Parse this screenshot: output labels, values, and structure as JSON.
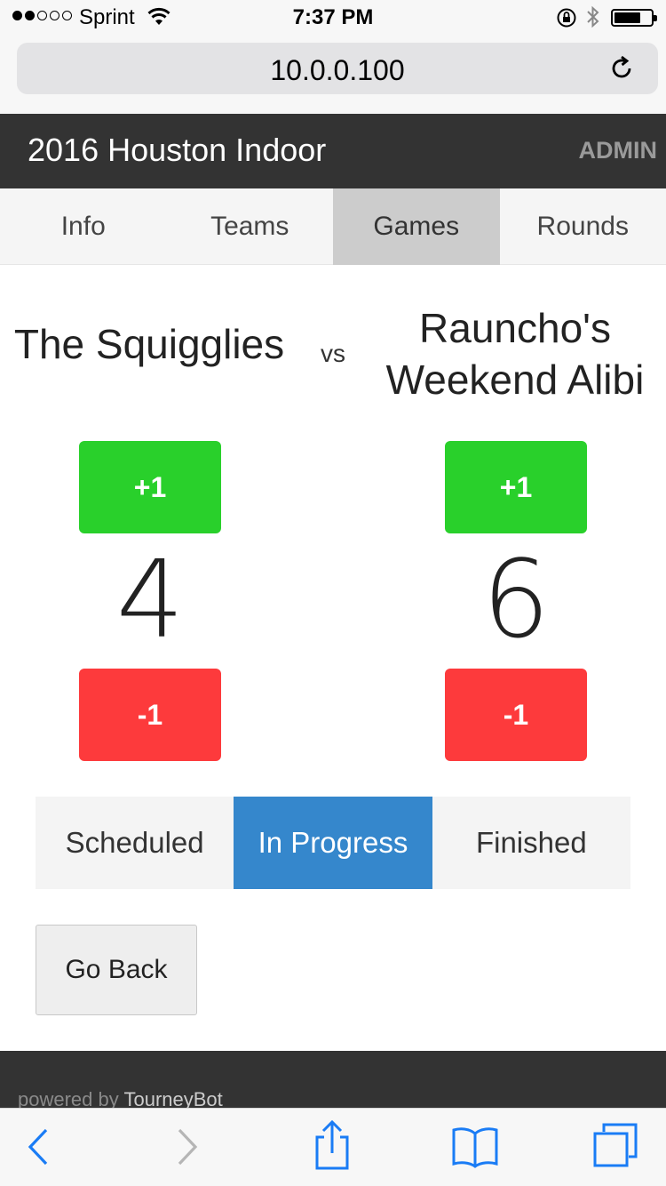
{
  "status_bar": {
    "carrier": "Sprint",
    "time": "7:37 PM",
    "signal_bars_filled": 2,
    "signal_bars_total": 5,
    "icons": [
      "wifi-icon",
      "rotation-lock-icon",
      "bluetooth-icon",
      "battery-icon"
    ]
  },
  "browser": {
    "url": "10.0.0.100",
    "toolbar_icons": [
      "back-icon",
      "forward-icon",
      "share-icon",
      "bookmarks-icon",
      "tabs-icon"
    ]
  },
  "header": {
    "title": "2016 Houston Indoor",
    "admin_label": "ADMIN"
  },
  "tabs": [
    {
      "label": "Info",
      "active": false
    },
    {
      "label": "Teams",
      "active": false
    },
    {
      "label": "Games",
      "active": true
    },
    {
      "label": "Rounds",
      "active": false
    }
  ],
  "game": {
    "vs_label": "vs",
    "team_left": {
      "name": "The Squigglies",
      "score": "4",
      "plus_label": "+1",
      "minus_label": "-1"
    },
    "team_right": {
      "name": "Rauncho's Weekend Alibi",
      "score": "6",
      "plus_label": "+1",
      "minus_label": "-1"
    }
  },
  "status_options": [
    {
      "label": "Scheduled",
      "active": false
    },
    {
      "label": "In Progress",
      "active": true
    },
    {
      "label": "Finished",
      "active": false
    }
  ],
  "go_back_label": "Go Back",
  "footer": {
    "prefix": "powered by",
    "brand": "TourneyBot"
  },
  "colors": {
    "header_bg": "#333333",
    "active_tab_bg": "#cccccc",
    "plus_button": "#29d02b",
    "minus_button": "#fd3a3c",
    "status_active": "#3587cc"
  }
}
